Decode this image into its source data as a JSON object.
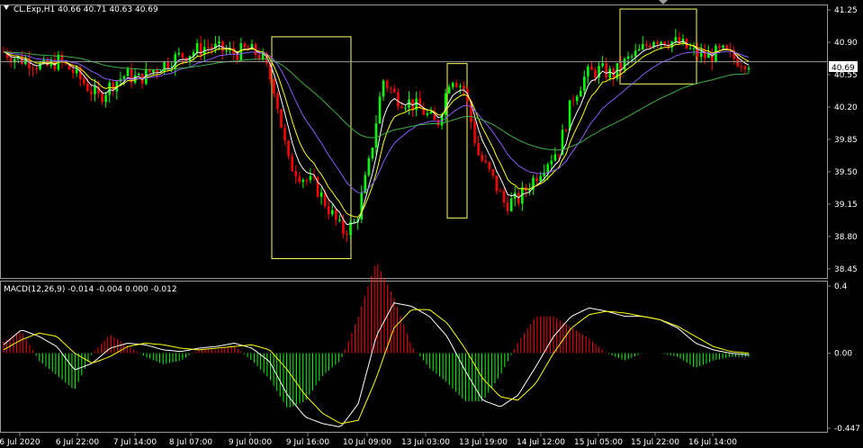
{
  "header": {
    "main": "CL.Exp,H1  40.66 40.71 40.63 40.69",
    "macd": "MACD(12,26,9) -0.014 -0.004 0.000 -0.012"
  },
  "price_badge": "40.69",
  "colors": {
    "background": "#000000",
    "bull": "#00ff00",
    "bear": "#ff0000",
    "ma_fast": "#ffffff",
    "ma_mid": "#ffff00",
    "ma_slow_purple": "#8a5cf6",
    "ma_slow_green": "#3cb043",
    "box": "#ffff66",
    "grid": "#808080"
  },
  "chart_data": [
    {
      "type": "candlestick",
      "symbol": "CL.Exp",
      "timeframe": "H1",
      "ohlc_last": {
        "open": 40.66,
        "high": 40.71,
        "low": 40.63,
        "close": 40.69
      },
      "y_ticks": [
        "41.25",
        "40.90",
        "40.55",
        "40.20",
        "39.85",
        "39.50",
        "39.15",
        "38.80",
        "38.45"
      ],
      "ylim": [
        38.38,
        41.28
      ],
      "current_price": 40.69,
      "x_ticks": [
        "6 Jul 2020",
        "6 Jul 22:00",
        "7 Jul 14:00",
        "8 Jul 07:00",
        "9 Jul 00:00",
        "9 Jul 16:00",
        "10 Jul 09:00",
        "13 Jul 03:00",
        "13 Jul 19:00",
        "14 Jul 12:00",
        "15 Jul 05:00",
        "15 Jul 22:00",
        "16 Jul 14:00"
      ],
      "close_path": [
        40.8,
        40.72,
        40.7,
        40.62,
        40.7,
        40.6,
        40.45,
        40.3,
        40.45,
        40.55,
        40.5,
        40.6,
        40.68,
        40.75,
        40.8,
        40.86,
        40.82,
        40.78,
        40.82,
        40.76,
        40.4,
        39.6,
        39.45,
        39.35,
        39.1,
        38.85,
        38.95,
        39.6,
        40.5,
        40.3,
        40.25,
        40.15,
        40.0,
        40.55,
        40.4,
        39.7,
        39.45,
        39.15,
        39.2,
        39.4,
        39.6,
        39.75,
        40.3,
        40.55,
        40.6,
        40.55,
        40.7,
        40.8,
        40.95,
        40.92,
        40.88,
        40.78,
        40.74,
        40.8,
        40.72,
        40.69
      ],
      "boxes": [
        {
          "from": "9 Jul 00:00",
          "to": "10 Jul 09:00",
          "high": 40.96,
          "low": 38.56
        },
        {
          "from": "13 Jul 03:00",
          "to": "13 Jul 19:00",
          "high": 40.67,
          "low": 39.0
        },
        {
          "from": "15 Jul 05:00",
          "to": "16 Jul 14:00",
          "high": 41.26,
          "low": 40.45
        }
      ]
    },
    {
      "type": "histogram",
      "indicator": "MACD(12,26,9)",
      "values_shown": [
        -0.014,
        -0.004,
        0.0,
        -0.012
      ],
      "y_ticks": [
        "0.4",
        "0.00",
        "-0.447"
      ],
      "ylim": [
        -0.447,
        0.4
      ],
      "macd_path": [
        0.05,
        0.14,
        0.1,
        0.04,
        -0.1,
        -0.06,
        0.03,
        0.06,
        0.05,
        0.02,
        0.01,
        0.03,
        0.04,
        0.06,
        0.03,
        -0.05,
        -0.25,
        -0.38,
        -0.42,
        -0.44,
        -0.3,
        0.1,
        0.3,
        0.28,
        0.22,
        0.1,
        -0.1,
        -0.28,
        -0.32,
        -0.25,
        -0.08,
        0.1,
        0.22,
        0.27,
        0.25,
        0.22,
        0.22,
        0.2,
        0.15,
        0.06,
        0.02,
        0.0,
        -0.01
      ],
      "signal_path": [
        0.02,
        0.08,
        0.12,
        0.1,
        0.0,
        -0.06,
        -0.02,
        0.04,
        0.06,
        0.05,
        0.03,
        0.02,
        0.03,
        0.04,
        0.05,
        0.02,
        -0.1,
        -0.25,
        -0.36,
        -0.42,
        -0.4,
        -0.15,
        0.15,
        0.26,
        0.26,
        0.18,
        0.03,
        -0.15,
        -0.26,
        -0.28,
        -0.18,
        0.0,
        0.15,
        0.23,
        0.25,
        0.24,
        0.22,
        0.2,
        0.16,
        0.1,
        0.04,
        0.01,
        0.0
      ]
    }
  ]
}
